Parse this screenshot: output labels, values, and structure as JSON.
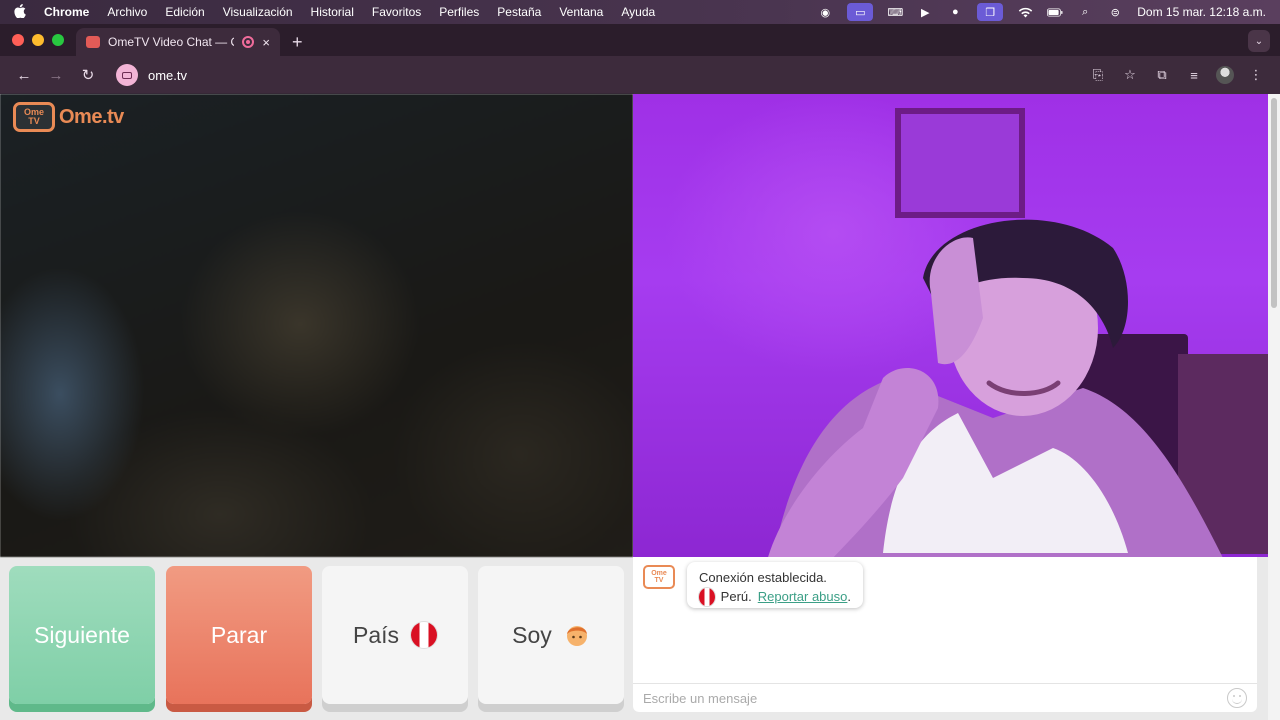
{
  "menubar": {
    "apple": "",
    "app": "Chrome",
    "items": [
      "Archivo",
      "Edición",
      "Visualización",
      "Historial",
      "Favoritos",
      "Perfiles",
      "Pestaña",
      "Ventana",
      "Ayuda"
    ],
    "clock": "Dom 15 mar.  12:18 a.m."
  },
  "browser": {
    "tab_title": "OmeTV Video Chat — Om",
    "new_tab": "+",
    "tab_close": "×",
    "url": "ome.tv"
  },
  "site": {
    "logo_top": "Ome",
    "logo_bottom": "TV",
    "logo_word": "Ome.tv",
    "buttons": {
      "next": "Siguiente",
      "stop": "Parar",
      "country": "País",
      "me": "Soy"
    },
    "chat": {
      "status": "Conexión establecida.",
      "country": "Perú.",
      "report": "Reportar abuso",
      "report_suffix": ".",
      "placeholder": "Escribe un mensaje"
    }
  },
  "colors": {
    "next": "#8fd6b1",
    "stop": "#ec8468",
    "brand": "#e98a55",
    "link": "#3b9f86"
  }
}
